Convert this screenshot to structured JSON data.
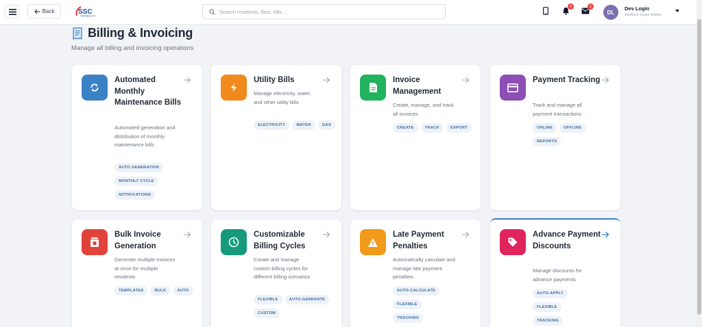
{
  "header": {
    "back_label": "Back",
    "logo_text": "SSC",
    "logo_sub": "TECHNOLOGY",
    "search_placeholder": "Search residents, flats, bills...",
    "notifications_count": "5",
    "messages_count": "1",
    "user": {
      "initials": "DL",
      "name": "Dev Login",
      "role": "Platform Super Admin"
    }
  },
  "page": {
    "title": "Billing & Invoicing",
    "subtitle": "Manage all billing and invoicing operations"
  },
  "colors": {
    "blue": "#3b82c4",
    "orange": "#f08a1c",
    "green": "#22b35e",
    "purple": "#8e4fb5",
    "red": "#e0433a",
    "teal": "#179a7b",
    "amber": "#f29a1a",
    "pink": "#e0245e",
    "accent": "#3b7fc4"
  },
  "cards": [
    {
      "title": "Automated Monthly Maintenance Bills",
      "description": "Automated generation and distribution of monthly maintenance bills",
      "icon": "refresh-icon",
      "tags": [
        "AUTO GENERATION",
        "MONTHLY CYCLE",
        "NOTIFICATIONS"
      ]
    },
    {
      "title": "Utility Bills",
      "description": "Manage electricity, water, and other utility bills",
      "icon": "bolt-icon",
      "tags": [
        "ELECTRICITY",
        "WATER",
        "GAS"
      ]
    },
    {
      "title": "Invoice Management",
      "description": "Create, manage, and track all invoices",
      "icon": "document-icon",
      "tags": [
        "CREATE",
        "TRACK",
        "EXPORT"
      ]
    },
    {
      "title": "Payment Tracking",
      "description": "Track and manage all payment transactions",
      "icon": "credit-card-icon",
      "tags": [
        "ONLINE",
        "OFFLINE",
        "REPORTS"
      ]
    },
    {
      "title": "Bulk Invoice Generation",
      "description": "Generate multiple invoices at once for multiple residents",
      "icon": "bulk-icon",
      "tags": [
        "TEMPLATES",
        "BULK",
        "AUTO"
      ]
    },
    {
      "title": "Customizable Billing Cycles",
      "description": "Create and manage custom billing cycles for different billing scenarios",
      "icon": "clock-icon",
      "tags": [
        "FLEXIBLE",
        "AUTO-GENERATE",
        "CUSTOM"
      ]
    },
    {
      "title": "Late Payment Penalties",
      "description": "Automatically calculate and manage late payment penalties",
      "icon": "warning-icon",
      "tags": [
        "AUTO-CALCULATE",
        "FLEXIBLE",
        "TRACKING"
      ]
    },
    {
      "title": "Advance Payment Discounts",
      "description": "Manage discounts for advance payments",
      "icon": "tag-icon",
      "tags": [
        "AUTO-APPLY",
        "FLEXIBLE",
        "TRACKING"
      ]
    }
  ]
}
